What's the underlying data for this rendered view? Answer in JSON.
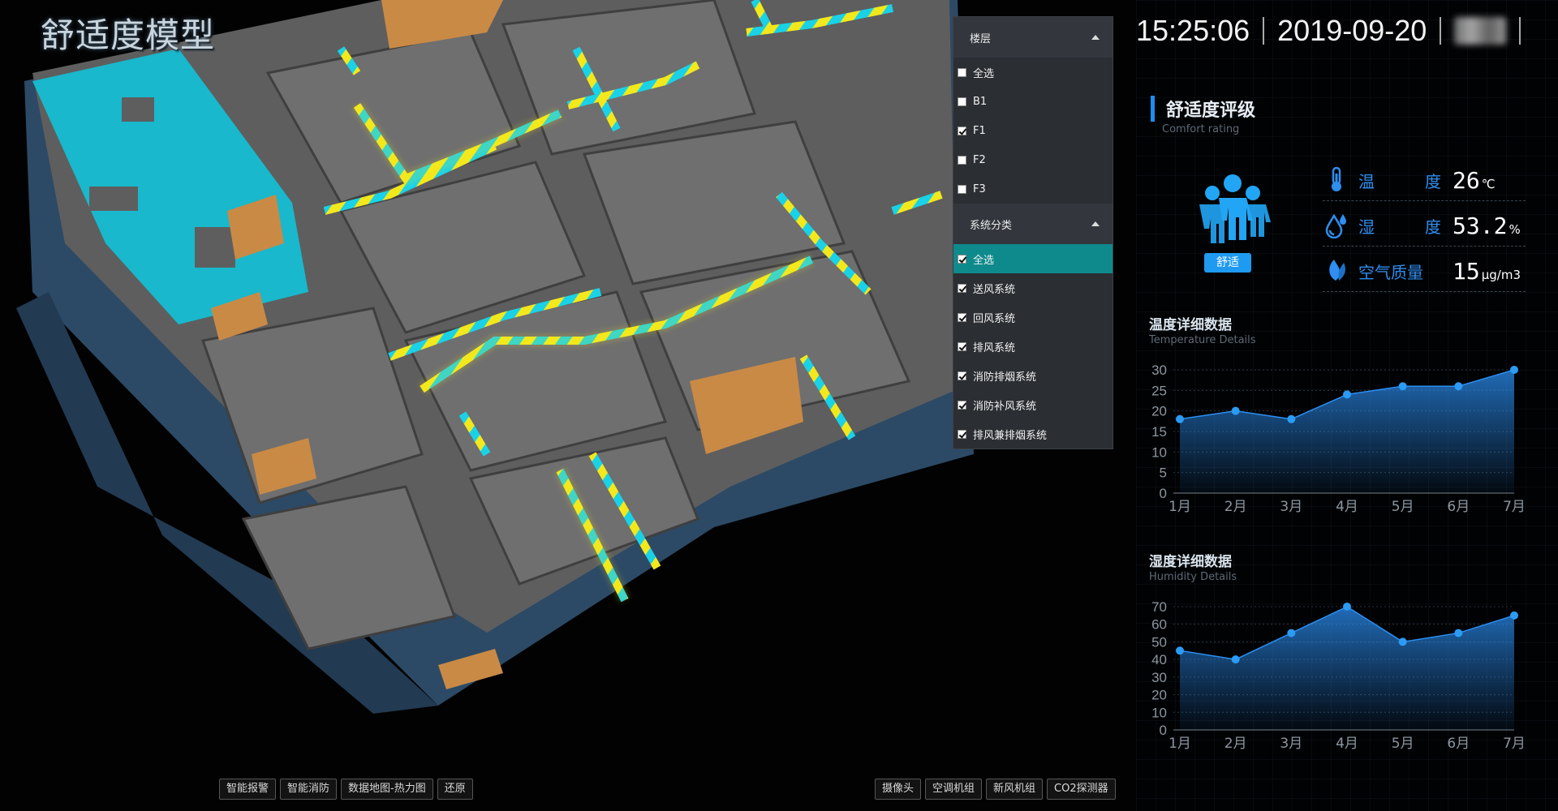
{
  "app": {
    "title": "舒适度模型"
  },
  "header": {
    "time": "15:25:06",
    "date": "2019-09-20"
  },
  "filter_panel": {
    "floor_group": {
      "label": "楼层",
      "options": [
        {
          "label": "全选",
          "checked": false
        },
        {
          "label": "B1",
          "checked": false
        },
        {
          "label": "F1",
          "checked": true
        },
        {
          "label": "F2",
          "checked": false
        },
        {
          "label": "F3",
          "checked": false
        }
      ]
    },
    "system_group": {
      "label": "系统分类",
      "options": [
        {
          "label": "全选",
          "checked": true,
          "active": true
        },
        {
          "label": "送风系统",
          "checked": true
        },
        {
          "label": "回风系统",
          "checked": true
        },
        {
          "label": "排风系统",
          "checked": true
        },
        {
          "label": "消防排烟系统",
          "checked": true
        },
        {
          "label": "消防补风系统",
          "checked": true
        },
        {
          "label": "排风兼排烟系统",
          "checked": true
        }
      ]
    }
  },
  "comfort": {
    "title": "舒适度评级",
    "subtitle": "Comfort rating",
    "status": "舒适",
    "metrics": [
      {
        "icon": "thermometer-icon",
        "label_a": "温",
        "label_b": "度",
        "value": "26",
        "unit": "℃"
      },
      {
        "icon": "water-drop-icon",
        "label_a": "湿",
        "label_b": "度",
        "value": "53.2",
        "unit": "%"
      },
      {
        "icon": "leaf-icon",
        "label_a": "空气质量",
        "label_b": "",
        "value": "15",
        "unit": "μg/m3"
      }
    ]
  },
  "temperature": {
    "title": "温度详细数据",
    "subtitle": "Temperature Details"
  },
  "humidity": {
    "title": "湿度详细数据",
    "subtitle": "Humidity Details"
  },
  "chart_data": [
    {
      "type": "area",
      "title": "温度详细数据",
      "categories": [
        "1月",
        "2月",
        "3月",
        "4月",
        "5月",
        "6月",
        "7月"
      ],
      "values": [
        18,
        20,
        18,
        24,
        26,
        26,
        30
      ],
      "ylim": [
        0,
        30
      ],
      "yticks": [
        0,
        5,
        10,
        15,
        20,
        25,
        30
      ],
      "grid": true,
      "color": "#2b8ef2"
    },
    {
      "type": "area",
      "title": "湿度详细数据",
      "categories": [
        "1月",
        "2月",
        "3月",
        "4月",
        "5月",
        "6月",
        "7月"
      ],
      "values": [
        45,
        40,
        55,
        70,
        50,
        55,
        65
      ],
      "ylim": [
        0,
        70
      ],
      "yticks": [
        0,
        10,
        20,
        30,
        40,
        50,
        60,
        70
      ],
      "grid": true,
      "color": "#2b8ef2"
    }
  ],
  "toolbar_left": [
    "智能报警",
    "智能消防",
    "数据地图-热力图",
    "还原"
  ],
  "toolbar_right": [
    "摄像头",
    "空调机组",
    "新风机组",
    "CO2探测器"
  ],
  "colors": {
    "accent": "#1f8df0",
    "active_row": "#0e8a8c",
    "duct_yellow": "#f3e81c",
    "duct_cyan": "#19d2e8",
    "zone_cyan": "#19b8cc",
    "wall_orange": "#c98a45"
  }
}
